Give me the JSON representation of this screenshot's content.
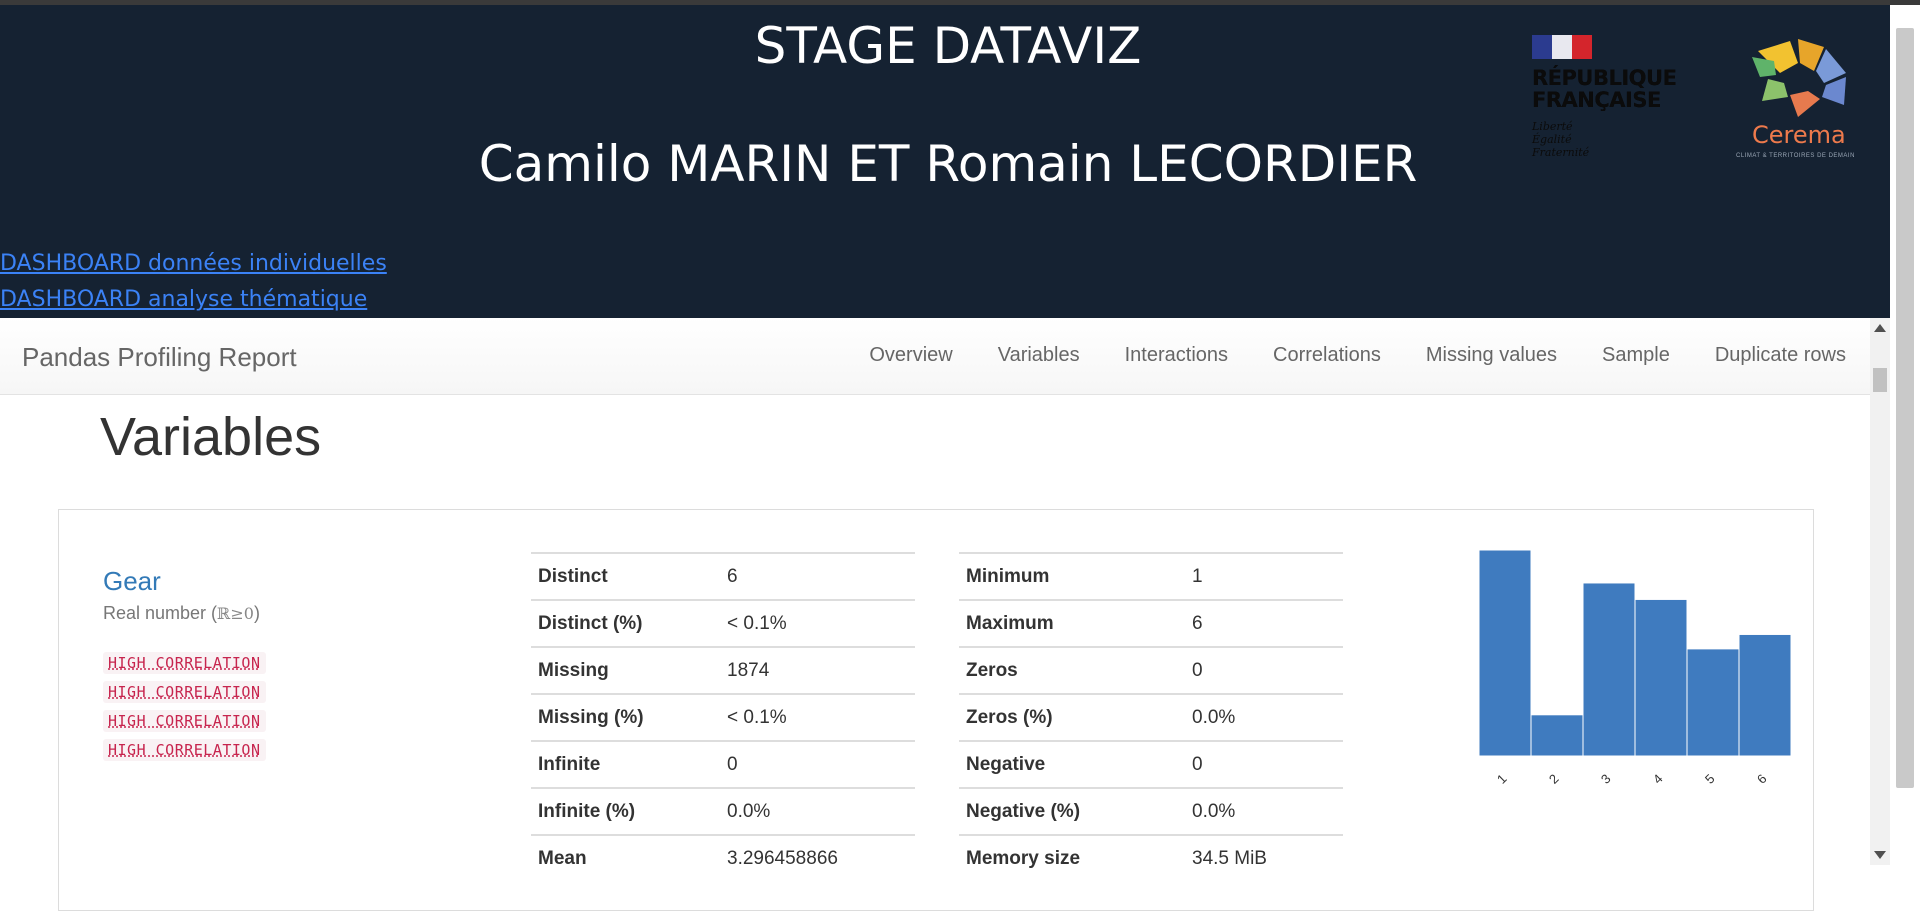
{
  "banner": {
    "title_line1": "STAGE DATAVIZ",
    "title_line2": "Camilo MARIN ET Romain LECORDIER",
    "links": [
      "DASHBOARD données individuelles",
      "DASHBOARD analyse thématique"
    ],
    "logo_rf": {
      "line1": "RÉPUBLIQUE",
      "line2": "FRANÇAISE",
      "motto": [
        "Liberté",
        "Égalité",
        "Fraternité"
      ]
    },
    "logo_cerema": {
      "name": "Cerema",
      "tagline": "CLIMAT & TERRITOIRES DE DEMAIN"
    }
  },
  "navbar": {
    "brand": "Pandas Profiling Report",
    "items": [
      "Overview",
      "Variables",
      "Interactions",
      "Correlations",
      "Missing values",
      "Sample",
      "Duplicate rows"
    ]
  },
  "section": {
    "title": "Variables"
  },
  "variable": {
    "name": "Gear",
    "type_label": "Real number (",
    "type_math": "ℝ≥0",
    "type_close": ")",
    "alerts": [
      "HIGH CORRELATION",
      "HIGH CORRELATION",
      "HIGH CORRELATION",
      "HIGH CORRELATION"
    ],
    "stats_left": [
      [
        "Distinct",
        "6"
      ],
      [
        "Distinct (%)",
        "< 0.1%"
      ],
      [
        "Missing",
        "1874"
      ],
      [
        "Missing (%)",
        "< 0.1%"
      ],
      [
        "Infinite",
        "0"
      ],
      [
        "Infinite (%)",
        "0.0%"
      ],
      [
        "Mean",
        "3.296458866"
      ]
    ],
    "stats_right": [
      [
        "Minimum",
        "1"
      ],
      [
        "Maximum",
        "6"
      ],
      [
        "Zeros",
        "0"
      ],
      [
        "Zeros (%)",
        "0.0%"
      ],
      [
        "Negative",
        "0"
      ],
      [
        "Negative (%)",
        "0.0%"
      ],
      [
        "Memory size",
        "34.5 MiB"
      ]
    ]
  },
  "chart_data": {
    "type": "bar",
    "categories": [
      "1",
      "2",
      "3",
      "4",
      "5",
      "6"
    ],
    "values": [
      100,
      20,
      84,
      76,
      52,
      59
    ],
    "title": "",
    "xlabel": "",
    "ylabel": "",
    "ylim": [
      0,
      100
    ],
    "grid": false,
    "color": "#3f7bbf"
  },
  "colors": {
    "banner_bg": "#152232",
    "link": "#3b82f6",
    "accent": "#337ab7",
    "badge_text": "#c7254e",
    "bar": "#3f7bbf"
  },
  "icons": {
    "scroll_up": "triangle-up-icon",
    "scroll_down": "triangle-down-icon"
  }
}
